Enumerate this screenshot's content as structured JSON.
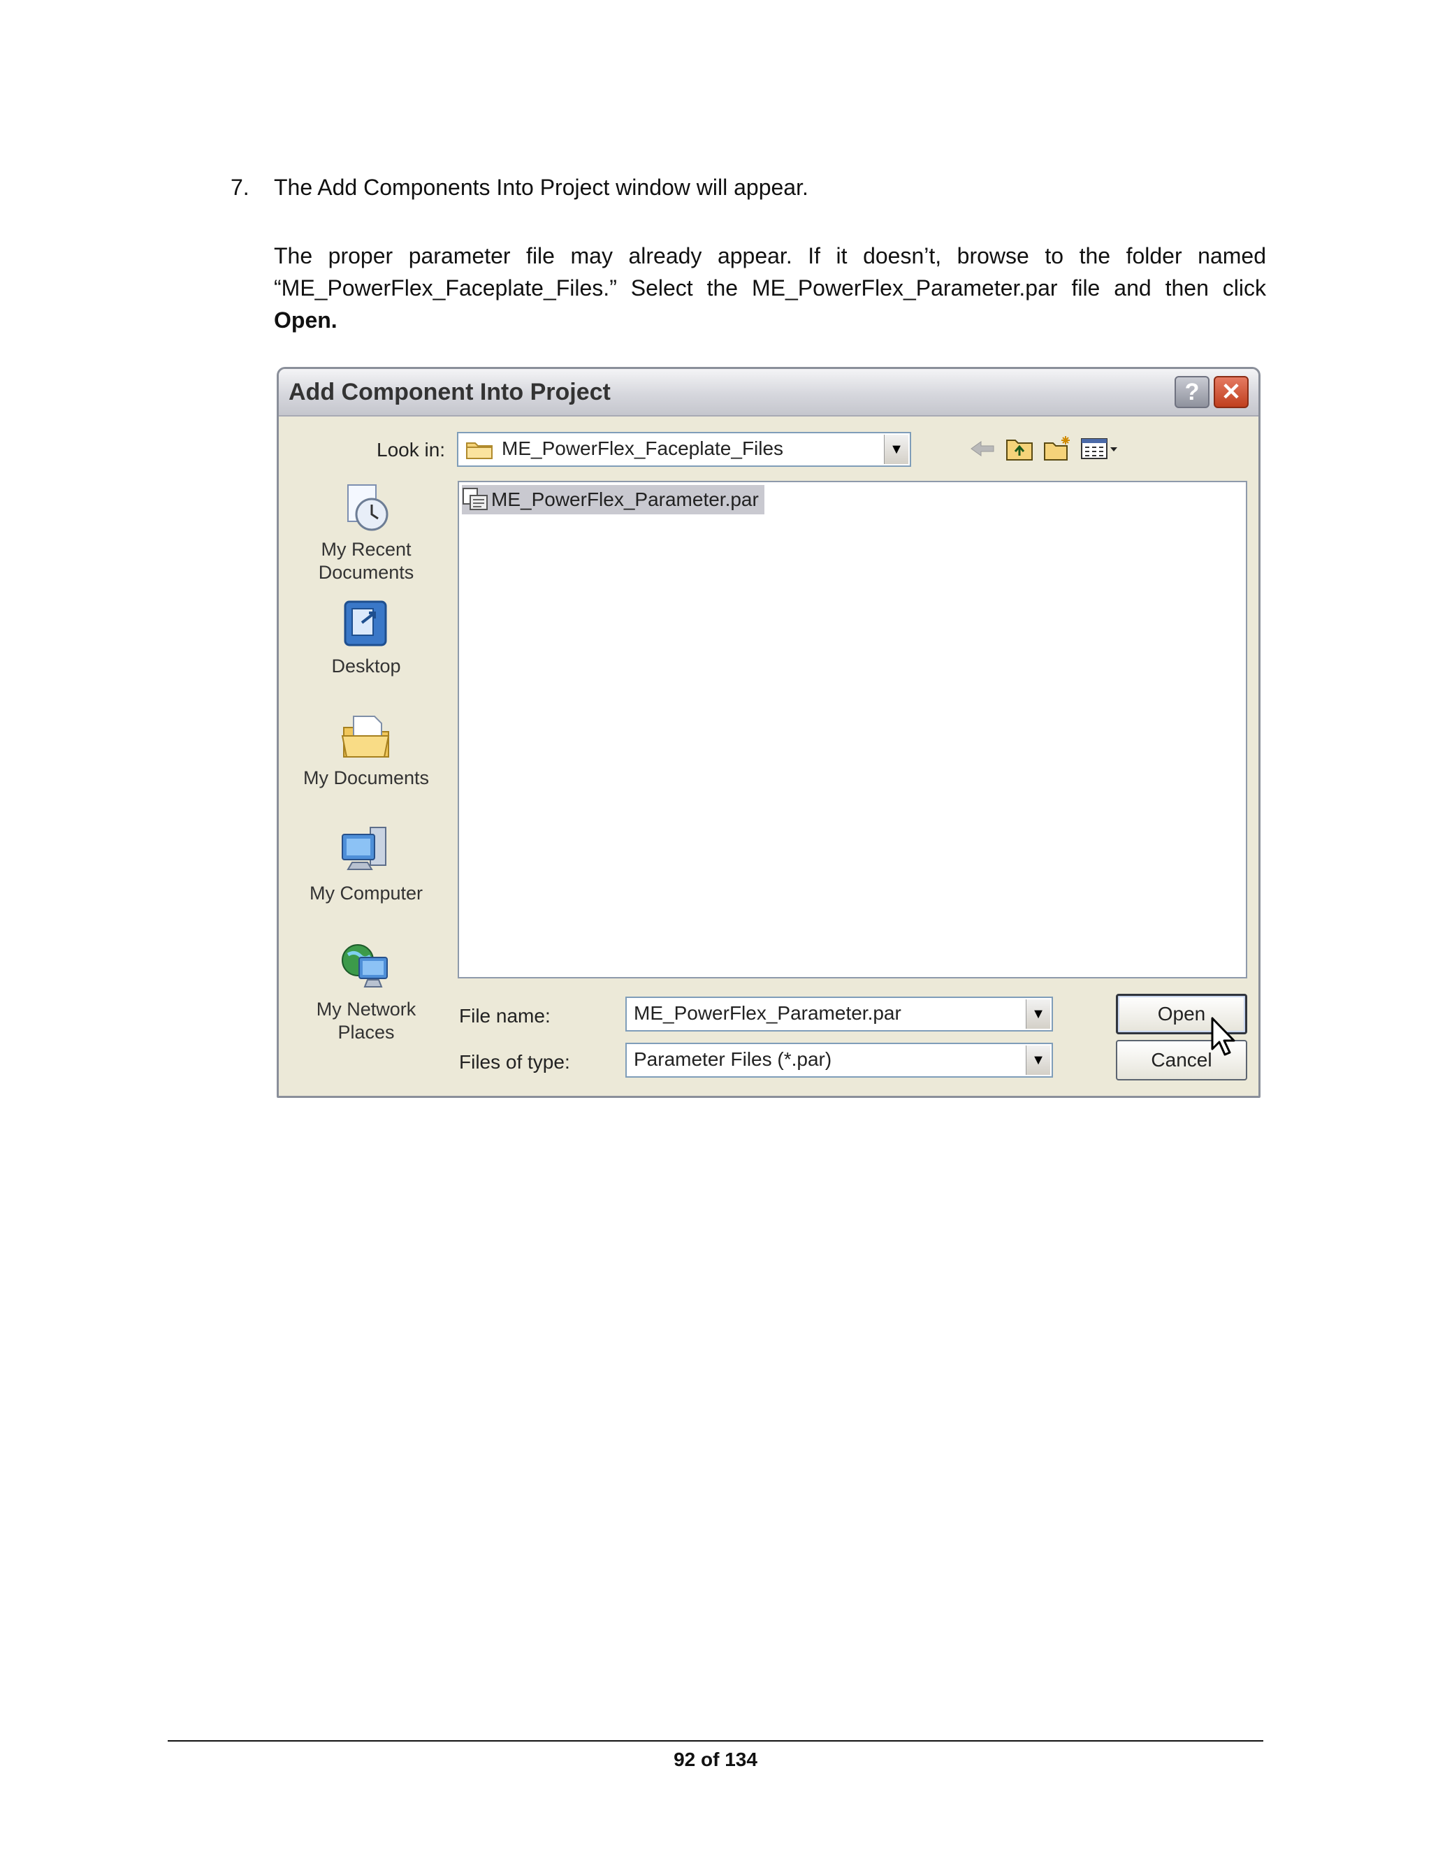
{
  "step": {
    "number": "7.",
    "text": "The  Add Components  Into  Project  window  will appear."
  },
  "paragraph": {
    "line1": "The  proper  parameter  file  may  already  appear.   If it doesn’t, browse  to the folder  named",
    "line2": "“ME_PowerFlex_Faceplate_Files.”   Select the ME_PowerFlex_Parameter.par  file and then click",
    "bold_word": "Open."
  },
  "dialog": {
    "title": "Add Component Into Project",
    "help_glyph": "?",
    "close_glyph": "✕",
    "look_in_label": "Look in:",
    "look_in_value": "ME_PowerFlex_Faceplate_Files",
    "places": [
      {
        "label_line1": "My Recent",
        "label_line2": "Documents",
        "icon": "recent-documents-icon"
      },
      {
        "label_line1": "Desktop",
        "label_line2": "",
        "icon": "desktop-icon"
      },
      {
        "label_line1": "My Documents",
        "label_line2": "",
        "icon": "my-documents-icon"
      },
      {
        "label_line1": "My Computer",
        "label_line2": "",
        "icon": "my-computer-icon"
      },
      {
        "label_line1": "My Network",
        "label_line2": "Places",
        "icon": "network-places-icon"
      }
    ],
    "files": [
      {
        "name": "ME_PowerFlex_Parameter.par",
        "selected": true
      }
    ],
    "file_name_label": "File name:",
    "file_name_value": "ME_PowerFlex_Parameter.par",
    "file_type_label": "Files of type:",
    "file_type_value": "Parameter Files (*.par)",
    "open_label": "Open",
    "cancel_label": "Cancel",
    "dropdown_glyph": "▼"
  },
  "footer": {
    "page": "92 of 134"
  },
  "colors": {
    "dialog_bg": "#ece9d8",
    "selection": "#c9c9d0",
    "close_red": "#c0401f"
  }
}
